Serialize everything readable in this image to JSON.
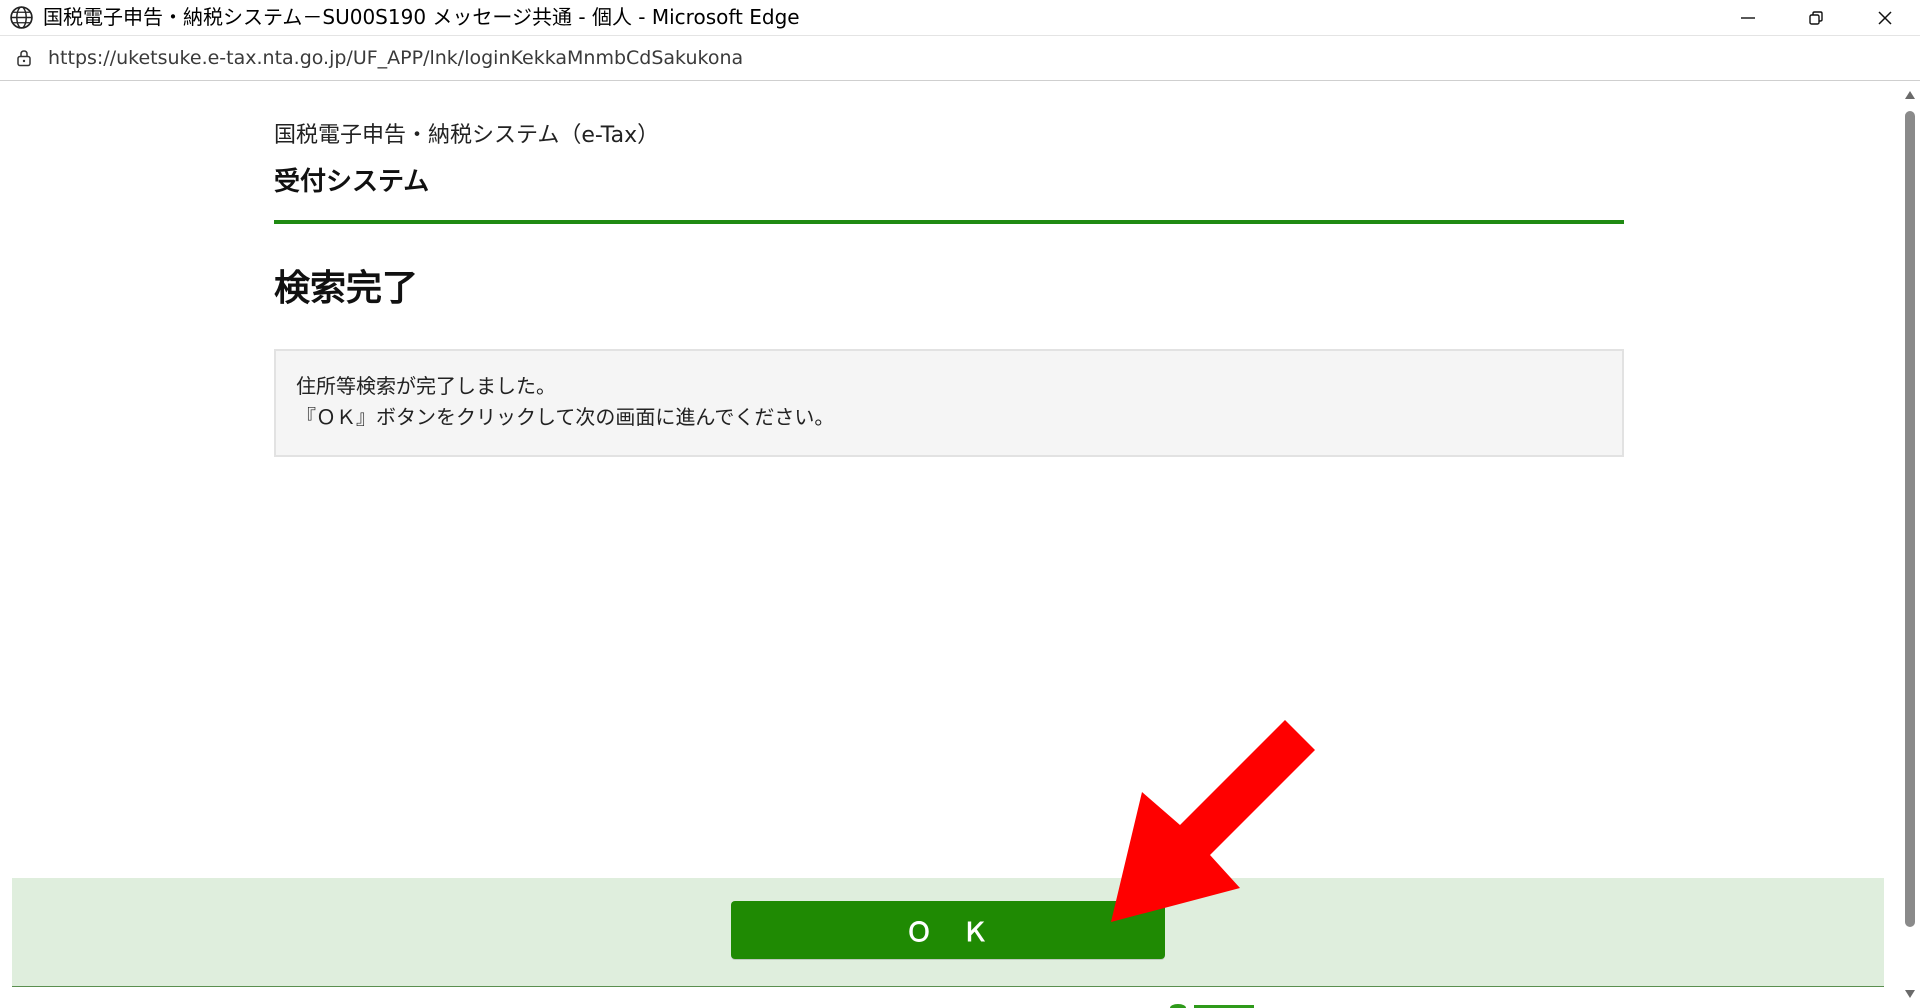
{
  "window": {
    "title": "国税電子申告・納税システム－SU00S190 メッセージ共通 - 個人 - Microsoft Edge",
    "icon": "globe-icon",
    "controls": {
      "minimize": "minimize-icon",
      "restore": "restore-icon",
      "close": "close-icon"
    }
  },
  "address_bar": {
    "url": "https://uketsuke.e-tax.nta.go.jp/UF_APP/lnk/loginKekkaMnmbCdSakukona",
    "icon": "lock-icon"
  },
  "page": {
    "system_name": "国税電子申告・納税システム（e-Tax）",
    "subsystem_name": "受付システム",
    "title": "検索完了",
    "message_lines": [
      "住所等検索が完了しました。",
      "『ＯＫ』ボタンをクリックして次の画面に進んでください。"
    ]
  },
  "footer": {
    "ok_label": "Ｏ　Ｋ"
  },
  "annotation": {
    "arrow_icon": "red-arrow-icon",
    "color": "#ff0000"
  },
  "colors": {
    "accent_green": "#1f8a12",
    "button_green": "#1f8a03",
    "action_bar_bg": "#dfeedd",
    "message_bg": "#f5f5f5"
  }
}
